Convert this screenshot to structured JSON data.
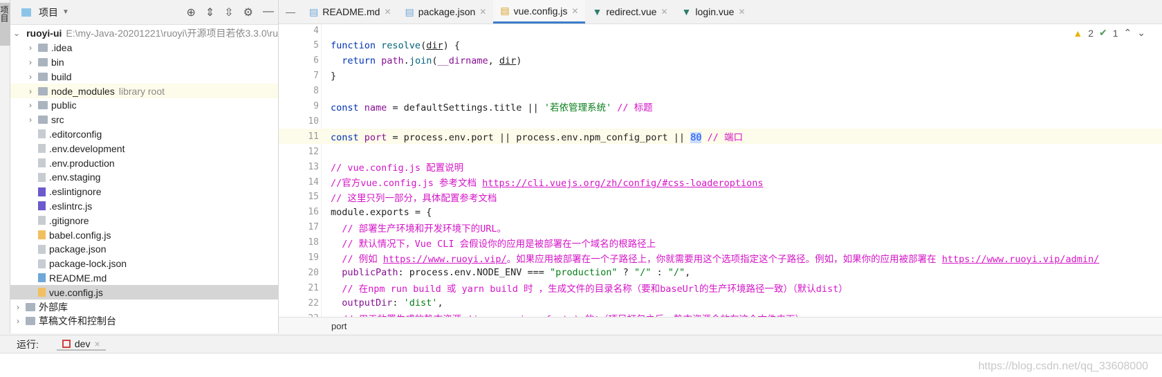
{
  "left_stripe": {
    "label": "项目"
  },
  "project_panel": {
    "title": "项目",
    "root": {
      "name": "ruoyi-ui",
      "path": "E:\\my-Java-20201221\\ruoyi\\开源项目若依3.3.0\\ru"
    },
    "items": [
      {
        "name": ".idea",
        "type": "folder",
        "hint": ""
      },
      {
        "name": "bin",
        "type": "folder",
        "hint": ""
      },
      {
        "name": "build",
        "type": "folder",
        "hint": ""
      },
      {
        "name": "node_modules",
        "type": "folder",
        "hint": "library root"
      },
      {
        "name": "public",
        "type": "folder",
        "hint": ""
      },
      {
        "name": "src",
        "type": "folder",
        "hint": ""
      },
      {
        "name": ".editorconfig",
        "type": "file",
        "hint": ""
      },
      {
        "name": ".env.development",
        "type": "file",
        "hint": ""
      },
      {
        "name": ".env.production",
        "type": "file",
        "hint": ""
      },
      {
        "name": ".env.staging",
        "type": "file",
        "hint": ""
      },
      {
        "name": ".eslintignore",
        "type": "file",
        "hint": ""
      },
      {
        "name": ".eslintrc.js",
        "type": "file",
        "hint": ""
      },
      {
        "name": ".gitignore",
        "type": "file",
        "hint": ""
      },
      {
        "name": "babel.config.js",
        "type": "file",
        "hint": ""
      },
      {
        "name": "package.json",
        "type": "file",
        "hint": ""
      },
      {
        "name": "package-lock.json",
        "type": "file",
        "hint": ""
      },
      {
        "name": "README.md",
        "type": "file",
        "hint": ""
      },
      {
        "name": "vue.config.js",
        "type": "file",
        "hint": "",
        "selected": true
      }
    ],
    "extra": [
      "外部库",
      "草稿文件和控制台"
    ]
  },
  "tabs": [
    {
      "label": "README.md"
    },
    {
      "label": "package.json"
    },
    {
      "label": "vue.config.js",
      "active": true
    },
    {
      "label": "redirect.vue"
    },
    {
      "label": "login.vue"
    }
  ],
  "inspections": {
    "warnings": "2",
    "typos": "1"
  },
  "code": [
    {
      "n": "4",
      "t": []
    },
    {
      "n": "5",
      "t": [
        [
          "kw",
          "function "
        ],
        [
          "fn",
          "resolve"
        ],
        [
          "",
          "("
        ],
        [
          "und",
          "dir"
        ],
        [
          "",
          ") {"
        ]
      ]
    },
    {
      "n": "6",
      "t": [
        [
          "kw",
          "  return "
        ],
        [
          "prop",
          "path"
        ],
        [
          "",
          "."
        ],
        [
          "fn",
          "join"
        ],
        [
          "",
          "("
        ],
        [
          "prop",
          "__dirname"
        ],
        [
          "",
          ", "
        ],
        [
          "und",
          "dir"
        ],
        [
          "",
          ")"
        ]
      ]
    },
    {
      "n": "7",
      "t": [
        [
          "",
          "}"
        ]
      ]
    },
    {
      "n": "8",
      "t": []
    },
    {
      "n": "9",
      "t": [
        [
          "kw",
          "const "
        ],
        [
          "prop",
          "name"
        ],
        [
          "",
          " = defaultSettings.title || "
        ],
        [
          "str",
          "'若依管理系统'"
        ],
        [
          "cm",
          " // 标题"
        ]
      ]
    },
    {
      "n": "10",
      "t": []
    },
    {
      "n": "11",
      "t": [
        [
          "kw",
          "const "
        ],
        [
          "prop",
          "port"
        ],
        [
          "",
          " = process.env.port || process.env.npm_config_port || "
        ],
        [
          "num",
          "80"
        ],
        [
          "cm",
          " // 端口"
        ]
      ],
      "current": true
    },
    {
      "n": "12",
      "t": []
    },
    {
      "n": "13",
      "t": [
        [
          "cm",
          "// vue.config.js 配置说明"
        ]
      ]
    },
    {
      "n": "14",
      "t": [
        [
          "cm",
          "//官方vue.config.js 参考文档 "
        ],
        [
          "cm lnk",
          "https://cli.vuejs.org/zh/config/#css-loaderoptions"
        ]
      ]
    },
    {
      "n": "15",
      "t": [
        [
          "cm",
          "// 这里只列一部分，具体配置参考文档"
        ]
      ]
    },
    {
      "n": "16",
      "t": [
        [
          "",
          "module.exports = {"
        ]
      ]
    },
    {
      "n": "17",
      "t": [
        [
          "cm",
          "  // 部署生产环境和开发环境下的URL。"
        ]
      ]
    },
    {
      "n": "18",
      "t": [
        [
          "cm",
          "  // 默认情况下，Vue CLI 会假设你的应用是被部署在一个域名的根路径上"
        ]
      ]
    },
    {
      "n": "19",
      "t": [
        [
          "cm",
          "  // 例如 "
        ],
        [
          "cm lnk",
          "https://www.ruoyi.vip/"
        ],
        [
          "cm",
          "。如果应用被部署在一个子路径上，你就需要用这个选项指定这个子路径。例如，如果你的应用被部署在 "
        ],
        [
          "cm lnk",
          "https://www.ruoyi.vip/admin/"
        ]
      ]
    },
    {
      "n": "20",
      "t": [
        [
          "prop",
          "  publicPath"
        ],
        [
          "",
          ": process.env.NODE_ENV === "
        ],
        [
          "str",
          "\"production\""
        ],
        [
          "",
          " ? "
        ],
        [
          "str",
          "\"/\""
        ],
        [
          "",
          " : "
        ],
        [
          "str",
          "\"/\""
        ],
        [
          "",
          ","
        ]
      ]
    },
    {
      "n": "21",
      "t": [
        [
          "cm",
          "  // 在npm run build 或 yarn build 时 ，生成文件的目录名称（要和baseUrl的生产环境路径一致）（默认dist）"
        ]
      ]
    },
    {
      "n": "22",
      "t": [
        [
          "prop",
          "  outputDir"
        ],
        [
          "",
          ": "
        ],
        [
          "str",
          "'dist'"
        ],
        [
          "",
          ","
        ]
      ]
    },
    {
      "n": "23",
      "t": [
        [
          "cm",
          "  // 用于放置生成的静态资源 (js、css、img、fonts) 的；（项目打包之后，静态资源会放在这个文件夹下）"
        ]
      ]
    }
  ],
  "breadcrumb": "port",
  "run_bar": {
    "label": "运行:",
    "tab": "dev"
  },
  "watermark": "https://blog.csdn.net/qq_33608000"
}
